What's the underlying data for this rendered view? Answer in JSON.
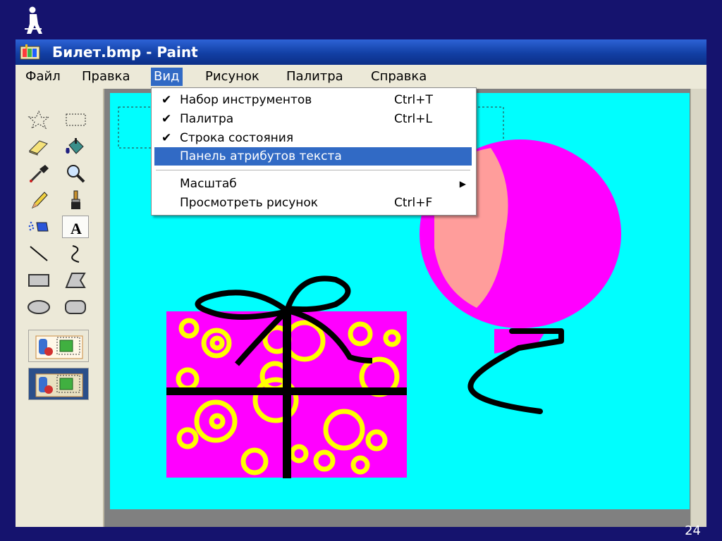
{
  "window": {
    "title": "Билет.bmp - Paint"
  },
  "menu": {
    "items": [
      {
        "label": "Файл"
      },
      {
        "label": "Правка"
      },
      {
        "label": "Вид",
        "active": true
      },
      {
        "label": "Рисунок"
      },
      {
        "label": "Палитра"
      },
      {
        "label": "Справка"
      }
    ]
  },
  "view_menu": {
    "items": [
      {
        "checked": true,
        "label": "Набор инструментов",
        "shortcut": "Ctrl+T"
      },
      {
        "checked": true,
        "label": "Палитра",
        "shortcut": "Ctrl+L"
      },
      {
        "checked": true,
        "label": "Строка состояния",
        "shortcut": ""
      },
      {
        "checked": false,
        "label": "Панель атрибутов текста",
        "shortcut": "",
        "highlighted": true
      },
      {
        "checked": false,
        "label": "Масштаб",
        "shortcut": "",
        "submenu": true
      },
      {
        "checked": false,
        "label": "Просмотреть рисунок",
        "shortcut": "Ctrl+F"
      }
    ],
    "check_glyph": "✔",
    "submenu_glyph": "▶"
  },
  "toolbox": {
    "tools": [
      "free-select-icon",
      "rect-select-icon",
      "eraser-icon",
      "fill-bucket-icon",
      "color-picker-icon",
      "magnifier-icon",
      "pencil-icon",
      "brush-icon",
      "airbrush-icon",
      "text-icon",
      "line-icon",
      "curve-icon",
      "rectangle-icon",
      "polygon-icon",
      "ellipse-icon",
      "rounded-rect-icon"
    ],
    "selected_tool": "text-icon",
    "text_tool_glyph": "A",
    "options": [
      "opaque-background-icon",
      "transparent-background-icon"
    ],
    "selected_option": "transparent-background-icon"
  },
  "canvas": {
    "background_color": "#00fefe",
    "gift_color": "#ff00ff",
    "pattern_color": "#ffff00",
    "ribbon_color": "#000000",
    "balloon_color": "#ff00ff",
    "highlight_color": "#ffd27a"
  },
  "slide": {
    "page_number": "24"
  },
  "colors": {
    "slide_background": "#15136e",
    "title_bar": "#0c3ba0",
    "menu_highlight": "#316ac5"
  }
}
